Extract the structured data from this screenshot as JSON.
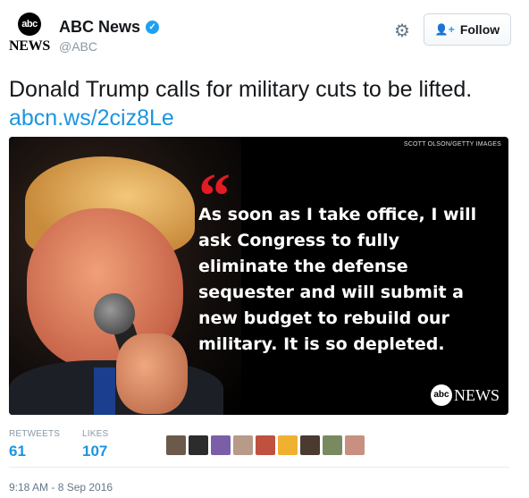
{
  "account": {
    "avatar_logo": "abc",
    "avatar_news": "NEWS",
    "display_name": "ABC News",
    "handle": "@ABC",
    "verified_icon": "verified-badge-icon"
  },
  "actions": {
    "settings_icon": "gear-icon",
    "follow_label": "Follow",
    "follow_icon": "add-user-icon"
  },
  "tweet": {
    "text": "Donald Trump calls for military cuts to be lifted.",
    "link": "abcn.ws/2ciz8Le"
  },
  "media": {
    "credit": "SCOTT OLSON/GETTY IMAGES",
    "quote_mark": "“",
    "quote": "As soon as I take office, I will ask Congress to fully eliminate the defense sequester and will submit a new budget to rebuild our military. It is so depleted.",
    "watermark_logo": "abc",
    "watermark_news": "NEWS",
    "colors": {
      "quote_mark": "#e31b23",
      "background": "#000000"
    }
  },
  "stats": {
    "retweets_label": "RETWEETS",
    "retweets_value": "61",
    "likes_label": "LIKES",
    "likes_value": "107",
    "likers": [
      {
        "color": "#6b5a4a"
      },
      {
        "color": "#2c2c2c"
      },
      {
        "color": "#7a5fa8"
      },
      {
        "color": "#b89a8a"
      },
      {
        "color": "#c05040"
      },
      {
        "color": "#f0b030"
      },
      {
        "color": "#4a3a30"
      },
      {
        "color": "#7a8a60"
      },
      {
        "color": "#c89080"
      }
    ]
  },
  "timestamp": "9:18 AM - 8 Sep 2016",
  "colors": {
    "link": "#1b95e0",
    "muted": "#8899a6"
  }
}
